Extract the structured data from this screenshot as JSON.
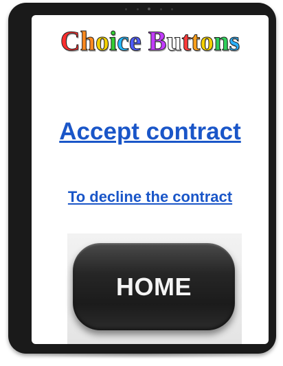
{
  "title": {
    "text": "Choice Buttons",
    "letter_colors": [
      "#ff2e2e",
      "#ff8a1f",
      "#f2d100",
      "#33cc33",
      "#22b8ff",
      "#4e5cff",
      "#c23bff",
      "#ffffff",
      "#ff3a3a",
      "#ff9f1a",
      "#f5d000",
      "#2fcf5a",
      "#2ab0ff",
      "#a43cff"
    ]
  },
  "links": {
    "accept": "Accept contract",
    "decline": "To decline the contract"
  },
  "home_button": {
    "label": "HOME"
  },
  "colors": {
    "link": "#1a56c8",
    "frame": "#1a1a1a",
    "button": "#1e1e1e"
  }
}
